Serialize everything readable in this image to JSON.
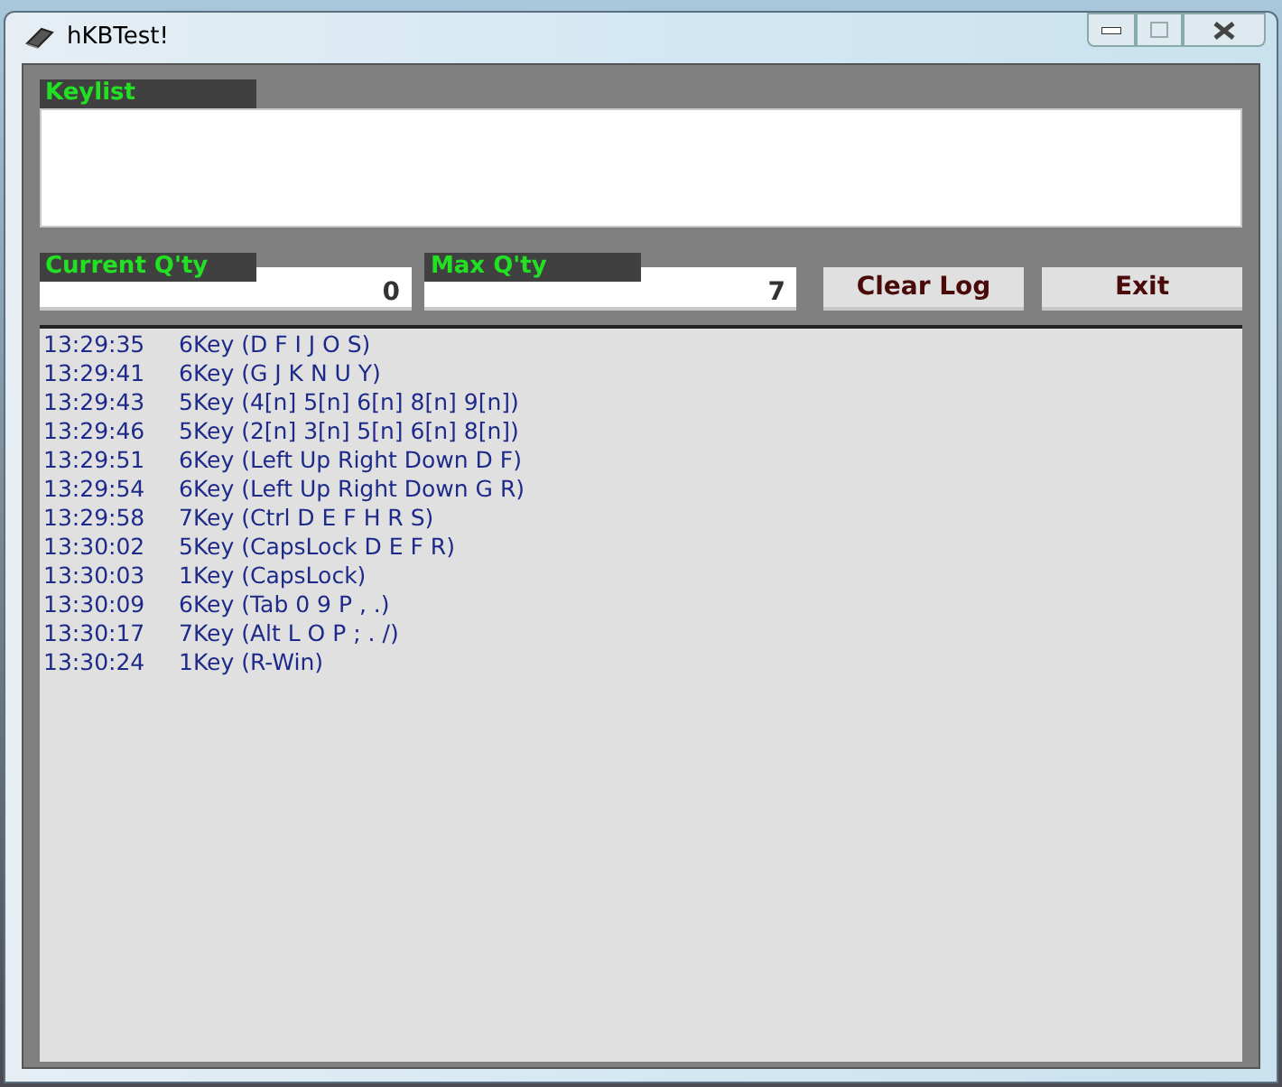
{
  "window": {
    "title": "hKBTest!"
  },
  "keylist": {
    "label": "Keylist"
  },
  "current_qty": {
    "label": "Current Q'ty",
    "value": "0"
  },
  "max_qty": {
    "label": "Max Q'ty",
    "value": "7"
  },
  "buttons": [
    "Clear Log",
    "Exit"
  ],
  "log": [
    {
      "time": "13:29:35",
      "entry": "6Key (D F I J O S)"
    },
    {
      "time": "13:29:41",
      "entry": "6Key (G J K N U Y)"
    },
    {
      "time": "13:29:43",
      "entry": "5Key (4[n] 5[n] 6[n] 8[n] 9[n])"
    },
    {
      "time": "13:29:46",
      "entry": "5Key (2[n] 3[n] 5[n] 6[n] 8[n])"
    },
    {
      "time": "13:29:51",
      "entry": "6Key (Left Up Right Down D F)"
    },
    {
      "time": "13:29:54",
      "entry": "6Key (Left Up Right Down G R)"
    },
    {
      "time": "13:29:58",
      "entry": "7Key (Ctrl D E F H R S)"
    },
    {
      "time": "13:30:02",
      "entry": "5Key (CapsLock D E F R)"
    },
    {
      "time": "13:30:03",
      "entry": "1Key (CapsLock)"
    },
    {
      "time": "13:30:09",
      "entry": "6Key (Tab 0 9 P , .)"
    },
    {
      "time": "13:30:17",
      "entry": "7Key (Alt L O P ; . /)"
    },
    {
      "time": "13:30:24",
      "entry": "1Key (R-Win)"
    }
  ]
}
